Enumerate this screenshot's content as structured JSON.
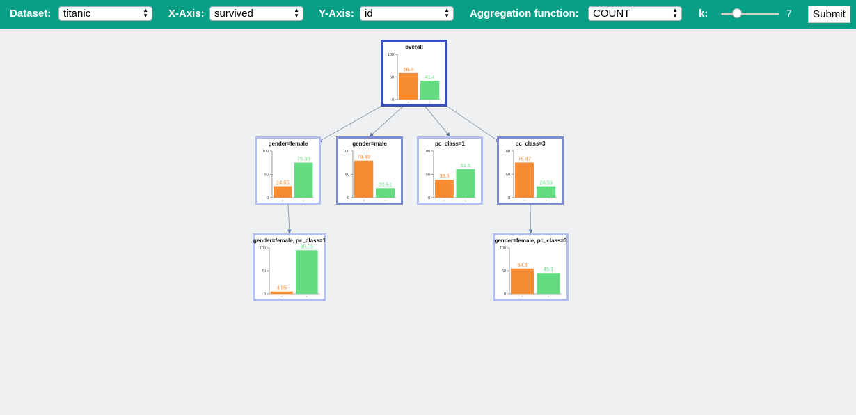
{
  "toolbar": {
    "dataset_label": "Dataset:",
    "dataset_value": "titanic",
    "xaxis_label": "X-Axis:",
    "xaxis_value": "survived",
    "yaxis_label": "Y-Axis:",
    "yaxis_value": "id",
    "agg_label": "Aggregation function:",
    "agg_value": "COUNT",
    "k_label": "k:",
    "k_value": "7",
    "submit_label": "Submit"
  },
  "colors": {
    "header": "#089f87",
    "series_0": "#f78c34",
    "series_1": "#64dd82",
    "strong_border": "#3b4fb5",
    "medium_border": "#7c8bcf",
    "light_border": "#b2bfec"
  },
  "chart_data": [
    {
      "type": "bar",
      "title": "overall",
      "categories": [
        "0",
        "1"
      ],
      "values": [
        58.6,
        41.4
      ],
      "ylim": [
        0,
        100
      ],
      "yticks": [
        0,
        50,
        100
      ]
    },
    {
      "type": "bar",
      "title": "gender=female",
      "categories": [
        "0",
        "1"
      ],
      "values": [
        24.65,
        75.35
      ],
      "ylim": [
        0,
        100
      ],
      "yticks": [
        0,
        50,
        100
      ]
    },
    {
      "type": "bar",
      "title": "gender=male",
      "categories": [
        "0",
        "1"
      ],
      "values": [
        79.49,
        20.51
      ],
      "ylim": [
        0,
        100
      ],
      "yticks": [
        0,
        50,
        100
      ]
    },
    {
      "type": "bar",
      "title": "pc_class=1",
      "categories": [
        "0",
        "1"
      ],
      "values": [
        38.5,
        61.5
      ],
      "ylim": [
        0,
        100
      ],
      "yticks": [
        0,
        50,
        100
      ]
    },
    {
      "type": "bar",
      "title": "pc_class=3",
      "categories": [
        "0",
        "1"
      ],
      "values": [
        75.47,
        24.53
      ],
      "ylim": [
        0,
        100
      ],
      "yticks": [
        0,
        50,
        100
      ]
    },
    {
      "type": "bar",
      "title": "gender=female, pc_class=1",
      "categories": [
        "0",
        "1"
      ],
      "values": [
        4.95,
        95.05
      ],
      "ylim": [
        0,
        100
      ],
      "yticks": [
        0,
        50,
        100
      ]
    },
    {
      "type": "bar",
      "title": "gender=female, pc_class=3",
      "categories": [
        "0",
        "1"
      ],
      "values": [
        54.9,
        45.1
      ],
      "ylim": [
        0,
        100
      ],
      "yticks": [
        0,
        50,
        100
      ]
    }
  ]
}
